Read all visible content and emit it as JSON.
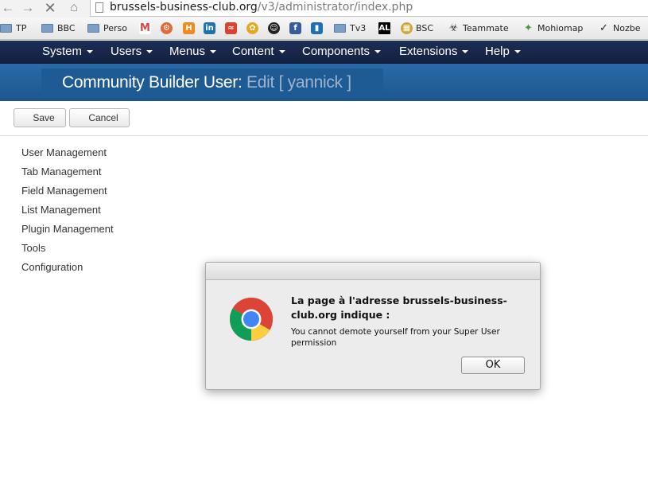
{
  "browser": {
    "url_host": "brussels-business-club.org",
    "url_path": "/v3/administrator/index.php",
    "bookmarks": [
      {
        "label": "TP",
        "icon": "folder-icon"
      },
      {
        "label": "BBC",
        "icon": "folder-icon"
      },
      {
        "label": "Perso",
        "icon": "folder-icon"
      },
      {
        "label": "",
        "icon": "gmail-icon"
      },
      {
        "label": "",
        "icon": "gear-icon"
      },
      {
        "label": "",
        "icon": "hootsuite-icon"
      },
      {
        "label": "",
        "icon": "linkedin-icon"
      },
      {
        "label": "",
        "icon": "feed-icon"
      },
      {
        "label": "",
        "icon": "flower-icon"
      },
      {
        "label": "",
        "icon": "smiley-icon"
      },
      {
        "label": "",
        "icon": "facebook-icon"
      },
      {
        "label": "",
        "icon": "trello-icon"
      },
      {
        "label": "Tv3",
        "icon": "folder-icon"
      },
      {
        "label": "",
        "icon": "al-icon",
        "text": "AL"
      },
      {
        "label": "BSC",
        "icon": "grid-icon"
      },
      {
        "label": "Teammate",
        "icon": "teammate-icon"
      },
      {
        "label": "Mohiomap",
        "icon": "mohiomap-icon"
      },
      {
        "label": "Nozbe",
        "icon": "nozbe-icon"
      }
    ]
  },
  "menu": {
    "items": [
      "System",
      "Users",
      "Menus",
      "Content",
      "Components",
      "Extensions",
      "Help"
    ]
  },
  "header": {
    "title_main": "Community Builder User:",
    "title_sub": "Edit [ yannick ]"
  },
  "toolbar": {
    "save_label": "Save",
    "cancel_label": "Cancel"
  },
  "sidebar": {
    "items": [
      "User Management",
      "Tab Management",
      "Field Management",
      "List Management",
      "Plugin Management",
      "Tools",
      "Configuration"
    ]
  },
  "dialog": {
    "heading": "La page à l'adresse brussels-business-club.org indique :",
    "message": "You cannot demote yourself from your Super User permission",
    "ok_label": "OK"
  },
  "colors": {
    "menubar": "#1c2e57",
    "titlebar": "#2b6aa8",
    "title_sub": "#9fb4cc"
  }
}
